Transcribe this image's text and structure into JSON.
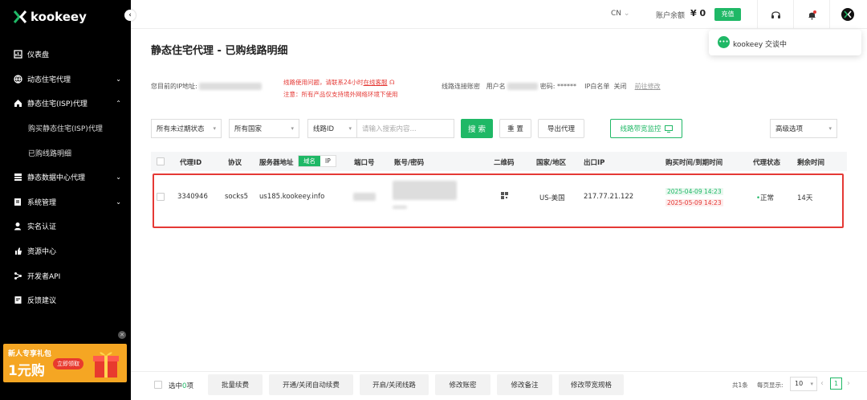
{
  "brand": {
    "name": "kookeey"
  },
  "sidebar": {
    "items": [
      {
        "label": "仪表盘",
        "icon": "dashboard-icon",
        "chevron": ""
      },
      {
        "label": "动态住宅代理",
        "icon": "globe-icon",
        "chevron": "⌄"
      },
      {
        "label": "静态住宅(ISP)代理",
        "icon": "home-icon",
        "chevron": "⌃"
      },
      {
        "label": "购买静态住宅(ISP)代理",
        "icon": "",
        "chevron": ""
      },
      {
        "label": "已购线路明细",
        "icon": "",
        "chevron": ""
      },
      {
        "label": "静态数据中心代理",
        "icon": "server-icon",
        "chevron": "⌄"
      },
      {
        "label": "系统管理",
        "icon": "settings-doc-icon",
        "chevron": "⌄"
      },
      {
        "label": "实名认证",
        "icon": "user-icon",
        "chevron": ""
      },
      {
        "label": "资源中心",
        "icon": "hand-icon",
        "chevron": ""
      },
      {
        "label": "开发者API",
        "icon": "api-icon",
        "chevron": ""
      },
      {
        "label": "反馈建议",
        "icon": "feedback-icon",
        "chevron": ""
      }
    ],
    "promo": {
      "line1": "新人专享礼包",
      "line2": "1元购",
      "button": "立即领取"
    }
  },
  "topbar": {
    "lang": "CN",
    "balance_label": "账户余额",
    "balance_value": "¥ 0",
    "charge": "充值"
  },
  "chat": {
    "label": "kookeey 交谈中"
  },
  "page": {
    "title": "静态住宅代理 - 已购线路明细",
    "ip_label": "您目前的IP地址:",
    "notice1": "线路使用问题，请联系24小时",
    "notice1_link": "在线客服",
    "notice2": "注意：所有产品仅支持境外网络环境下使用",
    "conn_label": "线路连接账密",
    "user_label": "用户名",
    "pwd_label": "密码:",
    "pwd_value": "******",
    "whitelist_label": "IP白名单",
    "whitelist_value": "关闭",
    "whitelist_link": "前往修改"
  },
  "filters": {
    "expiry": "所有未过期状态",
    "country": "所有国家",
    "field": "线路ID",
    "search_placeholder": "请输入搜索内容...",
    "search_btn": "搜 索",
    "reset_btn": "重 置",
    "export_btn": "导出代理",
    "bandwidth_btn": "线路带宽监控",
    "advanced": "高级选项"
  },
  "table": {
    "headers": [
      "代理ID",
      "协议",
      "服务器地址",
      "端口号",
      "账号/密码",
      "二维码",
      "国家/地区",
      "出口IP",
      "购买时间/到期时间",
      "代理状态",
      "剩余时间"
    ],
    "toggle": [
      "域名",
      "IP"
    ],
    "rows": [
      {
        "id": "3340946",
        "protocol": "socks5",
        "server": "us185.kookeey.info",
        "country": "US-美国",
        "ip": "217.77.21.122",
        "buy_time": "2025-04-09 14:23",
        "expire_time": "2025-05-09 14:23",
        "status": "正常",
        "remaining": "14天"
      }
    ]
  },
  "footer": {
    "selected_prefix": "选中",
    "selected_count": "0",
    "selected_suffix": "项",
    "buttons": [
      "批量续费",
      "开通/关闭自动续费",
      "开启/关闭线路",
      "修改账密",
      "修改备注",
      "修改带宽规格"
    ],
    "total": "共1条",
    "page_size_label": "每页显示:",
    "page_size": "10",
    "current_page": "1"
  },
  "colors": {
    "accent": "#1fb866",
    "danger": "#e53935",
    "sidebar_bg": "#000000"
  }
}
